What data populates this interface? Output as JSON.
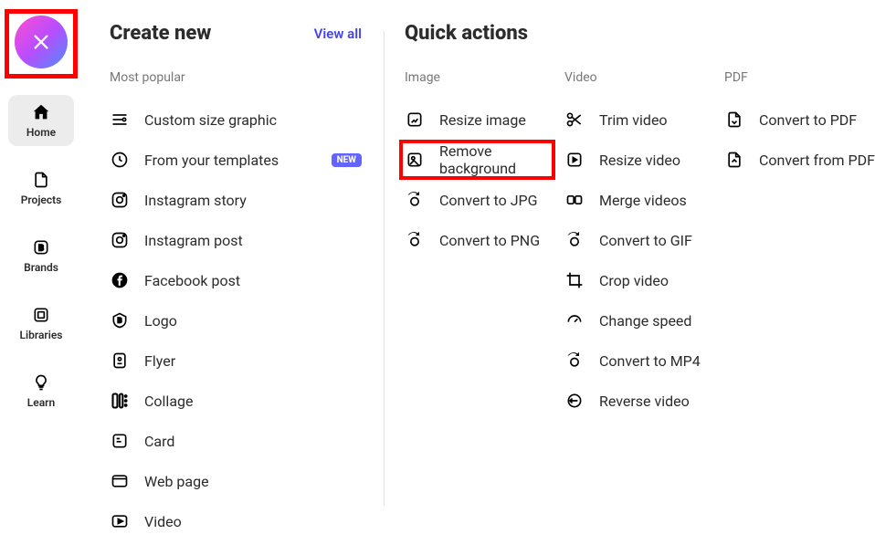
{
  "sidebar": {
    "items": [
      {
        "label": "Home",
        "active": true
      },
      {
        "label": "Projects"
      },
      {
        "label": "Brands"
      },
      {
        "label": "Libraries"
      },
      {
        "label": "Learn"
      }
    ]
  },
  "create": {
    "title": "Create new",
    "view_all": "View all",
    "subheading": "Most popular",
    "items": [
      {
        "label": "Custom size graphic"
      },
      {
        "label": "From your templates",
        "badge": "NEW"
      },
      {
        "label": "Instagram story"
      },
      {
        "label": "Instagram post"
      },
      {
        "label": "Facebook post"
      },
      {
        "label": "Logo"
      },
      {
        "label": "Flyer"
      },
      {
        "label": "Collage"
      },
      {
        "label": "Card"
      },
      {
        "label": "Web page"
      },
      {
        "label": "Video"
      }
    ]
  },
  "quick": {
    "title": "Quick actions",
    "groups": {
      "image": {
        "title": "Image",
        "items": [
          {
            "label": "Resize image"
          },
          {
            "label": "Remove background",
            "highlight": true
          },
          {
            "label": "Convert to JPG"
          },
          {
            "label": "Convert to PNG"
          }
        ]
      },
      "video": {
        "title": "Video",
        "items": [
          {
            "label": "Trim video"
          },
          {
            "label": "Resize video"
          },
          {
            "label": "Merge videos"
          },
          {
            "label": "Convert to GIF"
          },
          {
            "label": "Crop video"
          },
          {
            "label": "Change speed"
          },
          {
            "label": "Convert to MP4"
          },
          {
            "label": "Reverse video"
          }
        ]
      },
      "pdf": {
        "title": "PDF",
        "items": [
          {
            "label": "Convert to PDF"
          },
          {
            "label": "Convert from PDF"
          }
        ]
      }
    }
  }
}
